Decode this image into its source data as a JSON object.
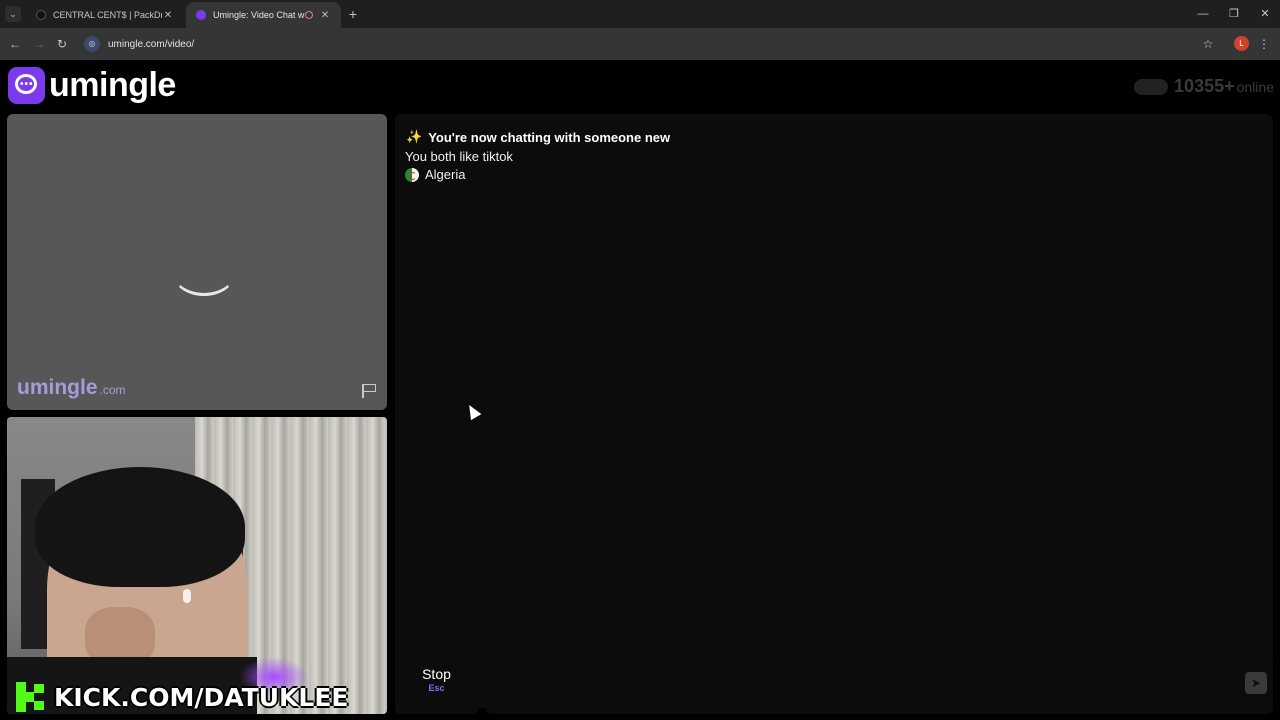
{
  "browser": {
    "tabs": [
      {
        "title": "CENTRAL CENT$ | PackDraw",
        "active": false
      },
      {
        "title": "Umingle: Video Chat with S",
        "active": true
      }
    ],
    "url": "umingle.com/video/",
    "profile_initial": "L"
  },
  "header": {
    "logo_text": "umingle",
    "online_count": "10355+",
    "online_label": "online"
  },
  "remote_video": {
    "watermark_name": "umingle",
    "watermark_tld": ".com"
  },
  "self_video": {
    "overlay_text": "KICK.COM/DATUKLEE"
  },
  "chat": {
    "status": "You're now chatting with someone new",
    "interest": "You both like tiktok",
    "country": "Algeria"
  },
  "controls": {
    "stop_label": "Stop",
    "stop_key": "Esc",
    "message_placeholder": ""
  },
  "colors": {
    "brand": "#7c3aed",
    "kick_green": "#53fc18",
    "panel_bg": "#0c0c0c"
  }
}
